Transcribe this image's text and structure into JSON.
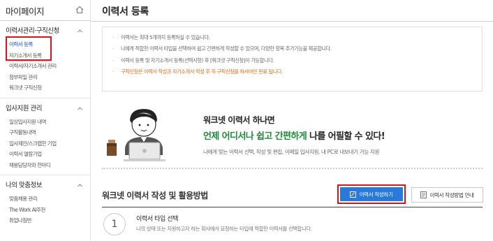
{
  "sidebar": {
    "title": "마이페이지",
    "sections": [
      {
        "title": "이력서관리·구직신청",
        "items": [
          {
            "label": "이력서 등록",
            "active": true
          },
          {
            "label": "자기소개서 등록",
            "active": false
          },
          {
            "label": "이력서/자기소개서 관리",
            "active": false
          },
          {
            "label": "첨부파일 관리",
            "active": false
          },
          {
            "label": "워크넷 구직신청",
            "active": false
          }
        ]
      },
      {
        "title": "입사지원 관리",
        "items": [
          {
            "label": "일상입사지원 내역",
            "active": false
          },
          {
            "label": "구직활동내역",
            "active": false
          },
          {
            "label": "입사제안/스크랩한 기업",
            "active": false
          },
          {
            "label": "이력서 열람기업",
            "active": false
          },
          {
            "label": "채용담당자와 한마디",
            "active": false
          }
        ]
      },
      {
        "title": "나의 맞춤정보",
        "items": [
          {
            "label": "맞춤채용 관리",
            "active": false
          },
          {
            "label": "The Work AI추천",
            "active": false
          },
          {
            "label": "취업나침반",
            "active": false
          }
        ]
      }
    ]
  },
  "main": {
    "title": "이력서 등록",
    "notices": [
      "이력서는 최대 5개까지 등록하실 수 있습니다.",
      "나에게 적합한 이력서 타입을 선택하여 쉽고 간편하게 작성할 수 있으며, 다양한 항목 추가기능을 제공합니다.",
      "이력서 등록 및 자기소개서 등록(선택사항) 후 [워크넷 구직신청]이 가능합니다.",
      "구직신청은 이력서 작성과 자기소개서 작성 후 꼭 구직신청을 하셔야만 완료 됩니다."
    ],
    "promo": {
      "headline": "워크넷 이력서 하나면",
      "slogan_a": "언제 어디서나 ",
      "slogan_b": "쉽고 간편하게",
      "slogan_c": " 나를 어필할 수 있다!",
      "sub": "나에게 맞는 이력서 선택, 작성 및 편집, 이메일 입사지원, 내 PC로 내보내기 가능 지원"
    },
    "howto": {
      "title": "워크넷 이력서 작성 및 활용방법",
      "write_button": "이력서 작성하기",
      "guide_button": "이력서 작성방법 안내"
    },
    "step": {
      "number": "1",
      "title": "이력서 타입 선택",
      "desc": "나의 상태 또는 지원하고자 하는 회사에서 요청하는 타입에 적합한 이력서를 선택합니다."
    }
  },
  "colors": {
    "accent_blue": "#2879d8",
    "highlight_red": "#e0101a",
    "warning_orange": "#e8680f",
    "slogan_green": "#1e8a3a",
    "active_link": "#1a4fd0"
  }
}
